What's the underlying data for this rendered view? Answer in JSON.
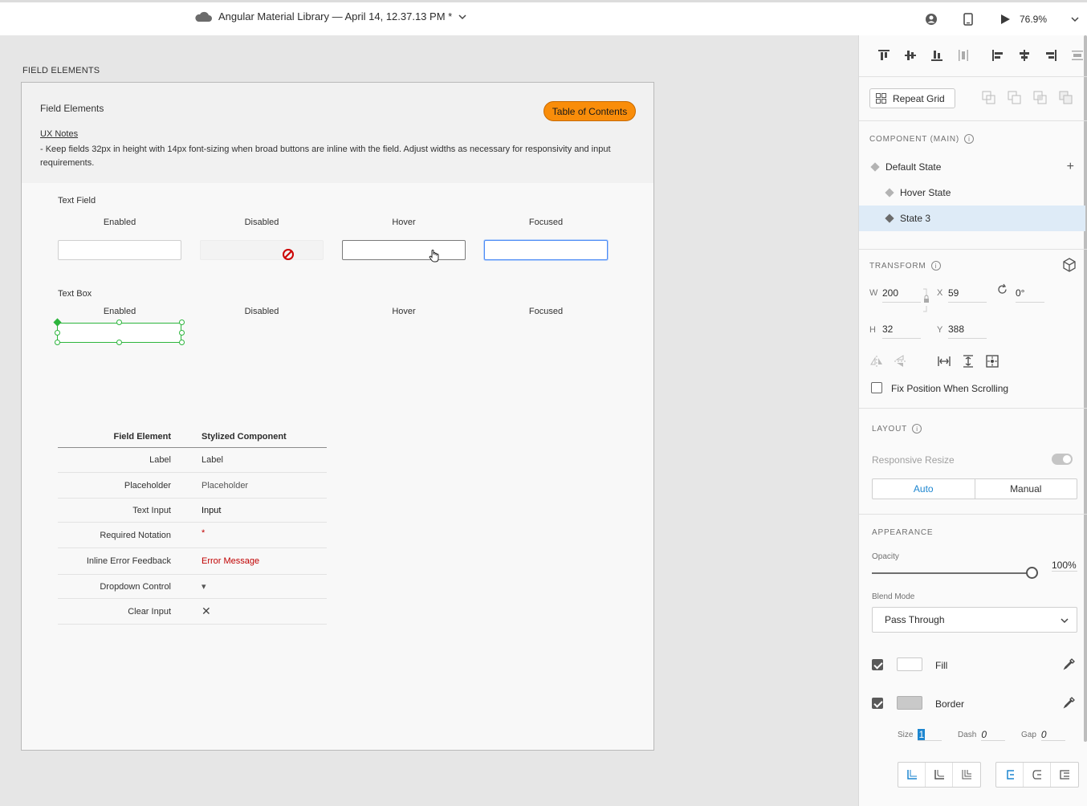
{
  "topbar": {
    "doc_title": "Angular Material Library — April 14, 12.37.13 PM *",
    "zoom": "76.9%"
  },
  "canvas": {
    "artboard_label": "FIELD ELEMENTS",
    "header": {
      "title": "Field Elements",
      "toc_button": "Table of Contents",
      "ux_notes_title": "UX Notes",
      "ux_notes_text": "- Keep fields 32px in height with 14px font-sizing when broad buttons are inline with the field. Adjust widths as necessary for responsivity and input requirements."
    },
    "text_field": {
      "label": "Text Field",
      "columns": [
        "Enabled",
        "Disabled",
        "Hover",
        "Focused"
      ]
    },
    "text_box": {
      "label": "Text Box",
      "columns": [
        "Enabled",
        "Disabled",
        "Hover",
        "Focused"
      ]
    },
    "table": {
      "headers": [
        "Field Element",
        "Stylized Component"
      ],
      "rows": [
        {
          "element": "Label",
          "component": "Label"
        },
        {
          "element": "Placeholder",
          "component": "Placeholder"
        },
        {
          "element": "Text Input",
          "component": "Input"
        },
        {
          "element": "Required Notation",
          "component": "*"
        },
        {
          "element": "Inline Error Feedback",
          "component": "Error Message"
        },
        {
          "element": "Dropdown Control",
          "component": "▾"
        },
        {
          "element": "Clear Input",
          "component": "✕"
        }
      ]
    }
  },
  "panel": {
    "repeat_grid": "Repeat Grid",
    "component_heading": "COMPONENT (MAIN)",
    "states": [
      "Default State",
      "Hover State",
      "State 3"
    ],
    "transform_heading": "TRANSFORM",
    "transform": {
      "w_label": "W",
      "w": "200",
      "x_label": "X",
      "x": "59",
      "rotation": "0°",
      "h_label": "H",
      "h": "32",
      "y_label": "Y",
      "y": "388"
    },
    "fix_position": "Fix Position When Scrolling",
    "layout_heading": "LAYOUT",
    "responsive_resize": "Responsive Resize",
    "layout_modes": [
      "Auto",
      "Manual"
    ],
    "appearance_heading": "APPEARANCE",
    "opacity_label": "Opacity",
    "opacity": "100%",
    "opacity_fraction": 1.0,
    "blend_mode_label": "Blend Mode",
    "blend_mode": "Pass Through",
    "fill_label": "Fill",
    "border_label": "Border",
    "stroke": {
      "size_label": "Size",
      "size": "1",
      "dash_label": "Dash",
      "dash": "0",
      "gap_label": "Gap",
      "gap": "0"
    },
    "colors": {
      "fill": "#ffffff",
      "border": "#c9c9c9",
      "accent": "#1d86d0",
      "toc": "#f98d0a",
      "selection": "#2db53d"
    }
  }
}
